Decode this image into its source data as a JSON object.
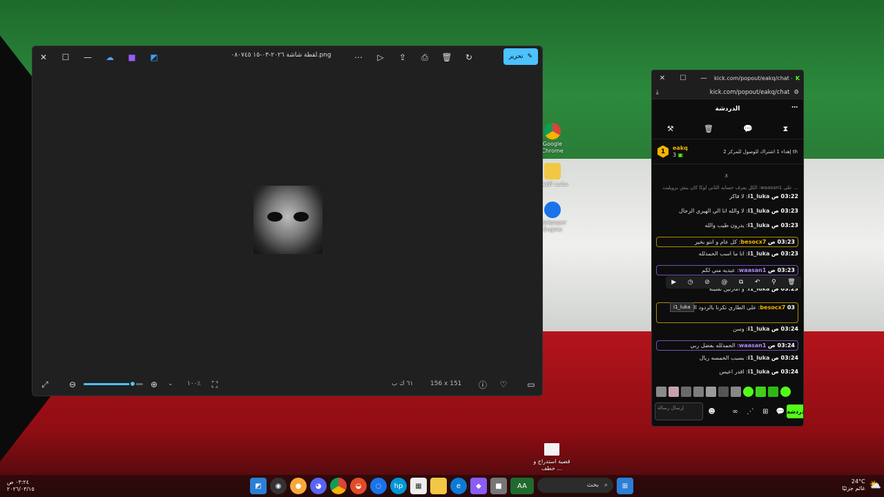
{
  "photos": {
    "title": "لقطة شاشة ٢٠٢٦-٠٣-١٥ ٠٨٠٧٤٥.png",
    "edit_label": "تحرير",
    "zoom": "١٠٠٪",
    "dimensions": "156 x 151",
    "file_size": "٦١ ك ب"
  },
  "desktop": {
    "icons": [
      "Google Chrome",
      "شاشة الإقفال",
      "Wallpaper Engine"
    ],
    "file_label": "قضية استدراج و خطف ..."
  },
  "chat": {
    "url": "kick.com/popout/eakq/chat",
    "tab_title": "kick.com/popout/eakq/chat - ...",
    "header": "الدردشة",
    "pinned_user": "eakq",
    "pinned_count": "3",
    "pinned_text": "إهداء 1 اشتراك للوصول للمركز 2",
    "pinned_rank": "th",
    "tooltip": "i1_luka",
    "input_placeholder": "إرسال رسالة",
    "send_label": "دردشة",
    "reply_preview": "… على waasan1: الكل يعرف حسابه الثاني لوكا كان ينش برويليت",
    "messages": [
      {
        "time": "03:22 ص",
        "user": "i1_luka",
        "text": "لا فاكر",
        "color": "#e0e0e0"
      },
      {
        "time": "03:23 ص",
        "user": "i1_luka",
        "text": "لا والله انا الي الهيري الرجال",
        "color": "#e0e0e0"
      },
      {
        "time": "03:23 ص",
        "user": "i1_luka",
        "text": "يدرون طيب والله",
        "color": "#e0e0e0"
      },
      {
        "time": "03:23 ص",
        "user": "besocx7",
        "text": "كل عام و انتو بخير",
        "color": "#f4b400"
      },
      {
        "time": "03:23 ص",
        "user": "i1_luka",
        "text": "انا ما اسب الحمدلله",
        "color": "#e0e0e0"
      },
      {
        "time": "03:23 ص",
        "user": "waasan1",
        "text": "عيديه مني لكم",
        "color": "#b48cff"
      },
      {
        "time": "03:23 ص",
        "user": "i1_luka",
        "text": "و امارتين نسيته",
        "color": "#e0e0e0"
      },
      {
        "time": "03",
        "user": "besocx7",
        "text": "على الطاري تكرنا بالردود الي بالعيد",
        "color": "#f4b400"
      },
      {
        "time": "03:24 ص",
        "user": "i1_luka",
        "text": "وسن",
        "color": "#e0e0e0"
      },
      {
        "time": "03:24 ص",
        "user": "waasan1",
        "text": "الحمدلله بفضل ربي",
        "color": "#b48cff"
      },
      {
        "time": "03:24 ص",
        "user": "i1_luka",
        "text": "بسبب الخمسه ريال",
        "color": "#e0e0e0"
      },
      {
        "time": "03:24 ص",
        "user": "i1_luka",
        "text": "اقدر اعيس",
        "color": "#e0e0e0"
      }
    ]
  },
  "taskbar": {
    "time": "٠٣:٢٤ ص",
    "date": "٢٠٢٦/٠٣/١٥",
    "search_placeholder": "بحث",
    "weather_temp": "24°C",
    "weather_desc": "غائم جزئيًا"
  }
}
